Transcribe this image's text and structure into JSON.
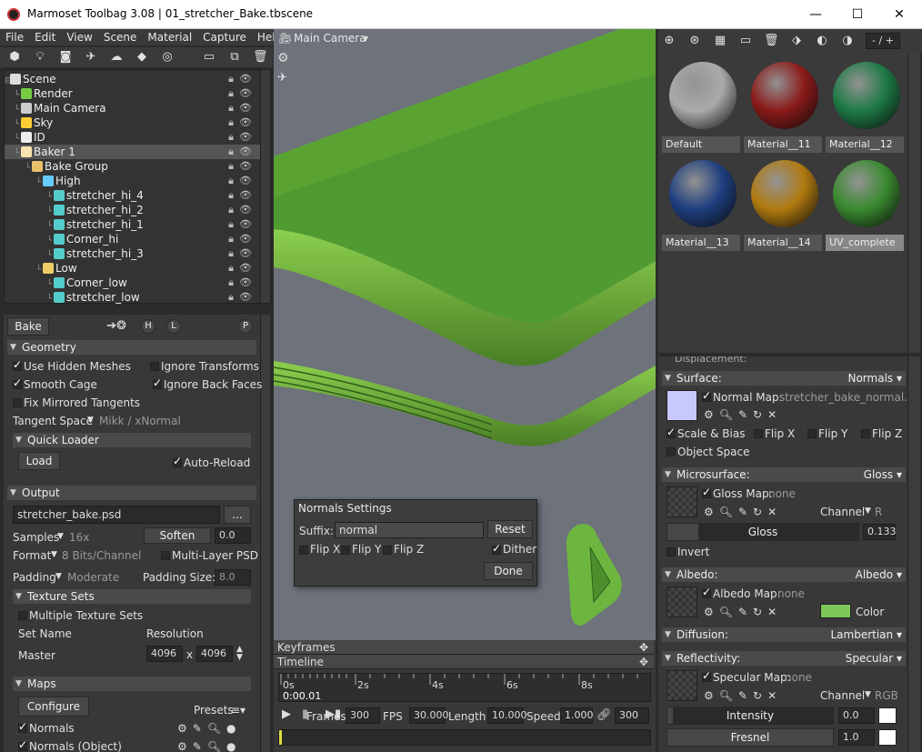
{
  "window": {
    "title": "Marmoset Toolbag 3.08  |  01_stretcher_Bake.tbscene",
    "minimize": "—",
    "maximize": "☐",
    "close": "✕"
  },
  "menu": [
    "File",
    "Edit",
    "View",
    "Scene",
    "Material",
    "Capture",
    "Help"
  ],
  "scene_tree": [
    {
      "label": "Scene",
      "depth": 0,
      "color": "#ddd"
    },
    {
      "label": "Render",
      "depth": 1,
      "color": "#7c4"
    },
    {
      "label": "Main Camera",
      "depth": 1,
      "color": "#ccc"
    },
    {
      "label": "Sky",
      "depth": 1,
      "color": "#fc3"
    },
    {
      "label": "ID",
      "depth": 1,
      "color": "#eee"
    },
    {
      "label": "Baker 1",
      "depth": 1,
      "color": "#f7e3b0",
      "selected": true
    },
    {
      "label": "Bake Group",
      "depth": 2,
      "color": "#e8c06a"
    },
    {
      "label": "High",
      "depth": 3,
      "color": "#6cf"
    },
    {
      "label": "stretcher_hi_4",
      "depth": 4,
      "color": "#5cc"
    },
    {
      "label": "stretcher_hi_2",
      "depth": 4,
      "color": "#5cc"
    },
    {
      "label": "stretcher_hi_1",
      "depth": 4,
      "color": "#5cc"
    },
    {
      "label": "Corner_hi",
      "depth": 4,
      "color": "#5cc"
    },
    {
      "label": "stretcher_hi_3",
      "depth": 4,
      "color": "#5cc"
    },
    {
      "label": "Low",
      "depth": 3,
      "color": "#ec6"
    },
    {
      "label": "Corner_low",
      "depth": 4,
      "color": "#5cc"
    },
    {
      "label": "stretcher_low",
      "depth": 4,
      "color": "#5cc"
    }
  ],
  "bake": {
    "tab": "Bake",
    "h_btn": "H",
    "l_btn": "L",
    "p_btn": "P",
    "geometry": {
      "title": "Geometry",
      "use_hidden": "Use Hidden Meshes",
      "ignore_transforms": "Ignore Transforms",
      "smooth_cage": "Smooth Cage",
      "ignore_back": "Ignore Back Faces",
      "fix_mirrored": "Fix Mirrored Tangents",
      "tangent_label": "Tangent Space",
      "tangent_value": "Mikk / xNormal"
    },
    "quick_loader": {
      "title": "Quick Loader",
      "load": "Load",
      "auto_reload": "Auto-Reload"
    },
    "output": {
      "title": "Output",
      "file": "stretcher_bake.psd",
      "browse": "...",
      "samples_label": "Samples",
      "samples_value": "16x",
      "soften": "Soften",
      "soften_value": "0.0",
      "format_label": "Format",
      "format_value": "8 Bits/Channel",
      "multilayer": "Multi-Layer PSD",
      "padding_label": "Padding",
      "padding_value": "Moderate",
      "padding_size_label": "Padding Size:",
      "padding_size": "8.0"
    },
    "texture_sets": {
      "title": "Texture Sets",
      "multiple": "Multiple Texture Sets",
      "set_name": "Set Name",
      "resolution": "Resolution",
      "master": "Master",
      "w": "4096",
      "x": "x",
      "h": "4096"
    },
    "maps": {
      "title": "Maps",
      "configure": "Configure",
      "presets": "Presets",
      "normals": "Normals",
      "normals_obj": "Normals (Object)"
    }
  },
  "viewport": {
    "camera": "Main Camera"
  },
  "normals_settings": {
    "title": "Normals Settings",
    "suffix_label": "Suffix:",
    "suffix": "normal",
    "reset": "Reset",
    "flip_x": "Flip X",
    "flip_y": "Flip Y",
    "flip_z": "Flip Z",
    "dither": "Dither",
    "done": "Done"
  },
  "timeline": {
    "keyframes": "Keyframes",
    "timeline": "Timeline",
    "ticks": [
      "0s",
      "2s",
      "4s",
      "6s",
      "8s"
    ],
    "time": "0:00.01",
    "frames_label": "Frames",
    "frames": "300",
    "fps_label": "FPS",
    "fps": "30.000",
    "length_label": "Length",
    "length": "10.000",
    "speed_label": "Speed",
    "speed": "1.000",
    "end": "300"
  },
  "materials": [
    {
      "name": "Default",
      "color": "#aaa"
    },
    {
      "name": "Material__11",
      "color": "#8b1a1a"
    },
    {
      "name": "Material__12",
      "color": "#1e7a45"
    },
    {
      "name": "Material__13",
      "color": "#1f3f80"
    },
    {
      "name": "Material__14",
      "color": "#b07a10"
    },
    {
      "name": "UV_complete",
      "color": "#3a8a30",
      "selected": true
    }
  ],
  "mat_counter": "- / +",
  "props": {
    "displacement": "Displacement:",
    "surface": {
      "title": "Surface:",
      "mode": "Normals",
      "map_label": "Normal Map:",
      "map": "stretcher_bake_normal.psd",
      "scale_bias": "Scale & Bias",
      "flip_x": "Flip X",
      "flip_y": "Flip Y",
      "flip_z": "Flip Z",
      "object_space": "Object Space"
    },
    "micro": {
      "title": "Microsurface:",
      "mode": "Gloss",
      "map_label": "Gloss Map:",
      "map": "none",
      "channel_label": "Channel",
      "channel": "R",
      "gloss_label": "Gloss",
      "gloss": "0.133",
      "invert": "Invert"
    },
    "albedo": {
      "title": "Albedo:",
      "mode": "Albedo",
      "map_label": "Albedo Map:",
      "map": "none",
      "color_label": "Color",
      "color": "#7ec85a"
    },
    "diffusion": {
      "title": "Diffusion:",
      "mode": "Lambertian"
    },
    "reflect": {
      "title": "Reflectivity:",
      "mode": "Specular",
      "map_label": "Specular Map:",
      "map": "none",
      "channel_label": "Channel",
      "channel": "RGB",
      "intensity_label": "Intensity",
      "intensity": "0.0",
      "fresnel_label": "Fresnel",
      "fresnel": "1.0"
    }
  }
}
